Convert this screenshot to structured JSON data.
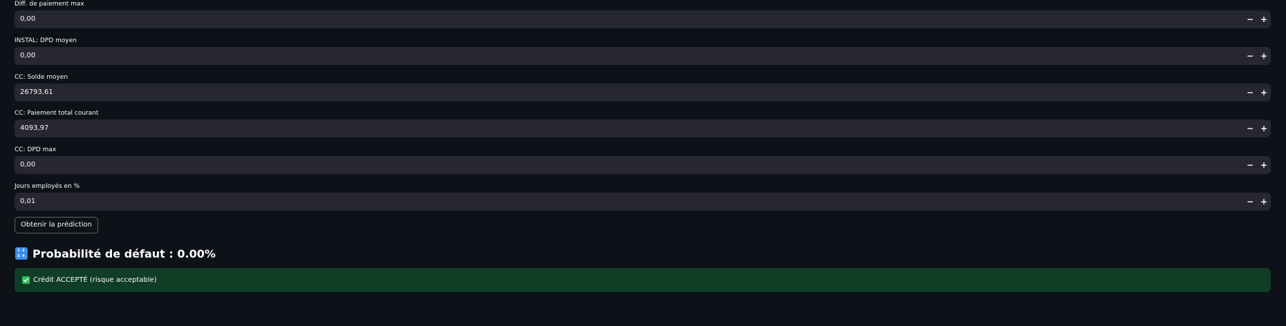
{
  "fields": [
    {
      "label": "Diff. de paiement max",
      "value": "0,00"
    },
    {
      "label": "INSTAL: DPD moyen",
      "value": "0,00"
    },
    {
      "label": "CC: Solde moyen",
      "value": "26793,61"
    },
    {
      "label": "CC: Paiement total courant",
      "value": "4093,97"
    },
    {
      "label": "CC: DPD max",
      "value": "0,00"
    },
    {
      "label": "Jours employés en %",
      "value": "0,01"
    }
  ],
  "stepper": {
    "minus": "−",
    "plus": "+"
  },
  "predict_button": "Obtenir la prédiction",
  "result": {
    "icon": "input-numbers-icon",
    "icon_digits": [
      "1",
      "2",
      "3",
      "4"
    ],
    "heading": "Probabilité de défaut : 0.00%"
  },
  "alert": {
    "icon": "check-mark-button-icon",
    "text": "Crédit ACCEPTÉ (risque acceptable)"
  },
  "colors": {
    "background": "#0e1117",
    "input_background": "#262730",
    "success_background": "#0f3d26",
    "success_check": "#2fbf5b",
    "icon_blue": "#3b8eea",
    "text": "#fafafa"
  }
}
